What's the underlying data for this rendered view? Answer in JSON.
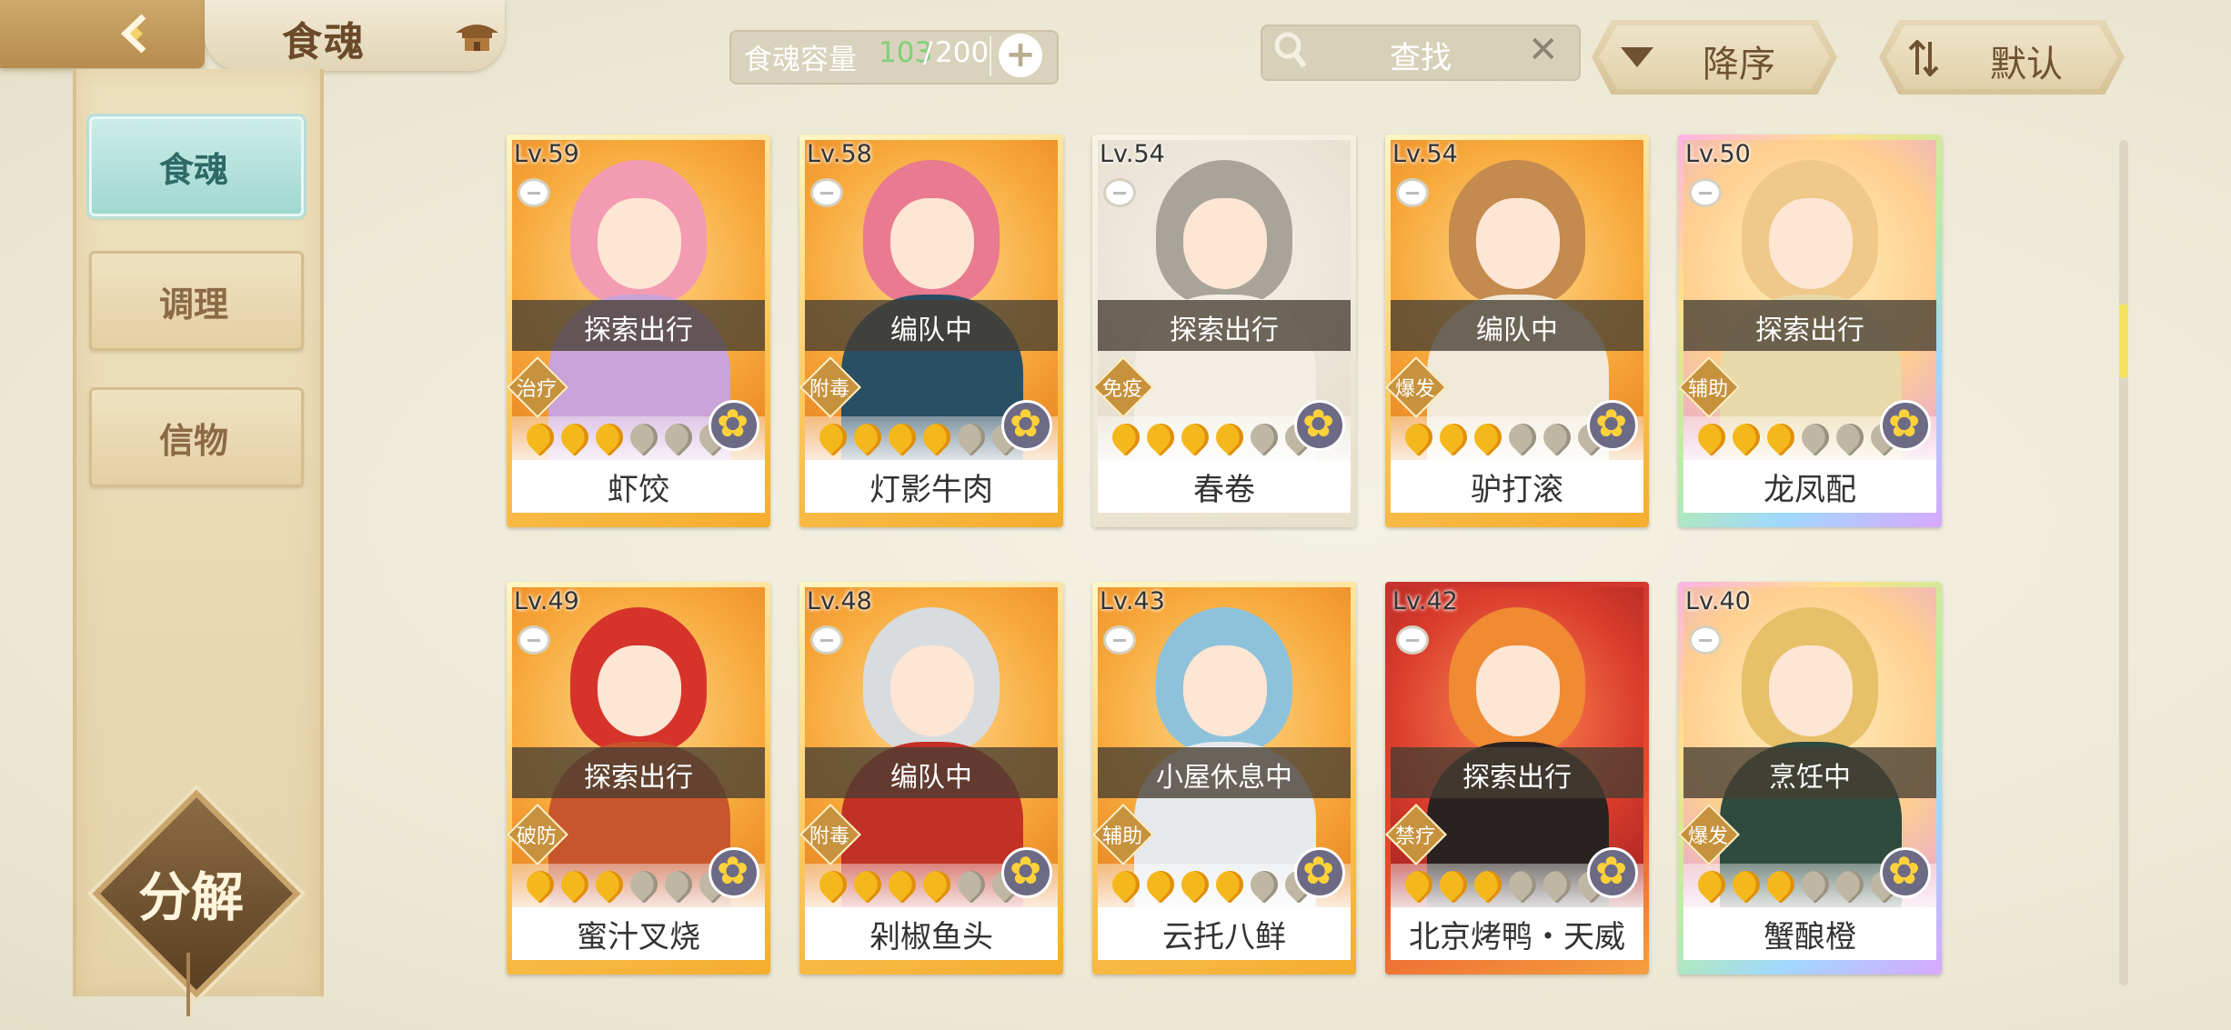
{
  "header": {
    "title": "食魂",
    "capacity": {
      "label": "食魂容量",
      "current": "103",
      "separator": "/",
      "max": "200"
    },
    "search": {
      "placeholder": "查找"
    },
    "sort_order_label": "降序",
    "sort_mode_label": "默认"
  },
  "sidebar": {
    "tabs": [
      {
        "label": "食魂",
        "active": true
      },
      {
        "label": "调理",
        "active": false
      },
      {
        "label": "信物",
        "active": false
      }
    ],
    "decompose_label": "分解"
  },
  "cards": [
    {
      "level": "Lv.59",
      "status": "探索出行",
      "role": "治疗",
      "name": "虾饺",
      "stars": 3,
      "max_stars": 6,
      "frame": "gold",
      "hair": "#f39bb3",
      "body": "#c9a2d8"
    },
    {
      "level": "Lv.58",
      "status": "编队中",
      "role": "附毒",
      "name": "灯影牛肉",
      "stars": 4,
      "max_stars": 6,
      "frame": "gold",
      "hair": "#e97a8f",
      "body": "#2a4e63"
    },
    {
      "level": "Lv.54",
      "status": "探索出行",
      "role": "免疫",
      "name": "春卷",
      "stars": 4,
      "max_stars": 6,
      "frame": "plain",
      "hair": "#a9a49a",
      "body": "#f3efe4"
    },
    {
      "level": "Lv.54",
      "status": "编队中",
      "role": "爆发",
      "name": "驴打滚",
      "stars": 3,
      "max_stars": 6,
      "frame": "gold",
      "hair": "#c48a4e",
      "body": "#f1ead8"
    },
    {
      "level": "Lv.50",
      "status": "探索出行",
      "role": "辅助",
      "name": "龙凤配",
      "stars": 3,
      "max_stars": 6,
      "frame": "rainbow",
      "hair": "#efc88a",
      "body": "#e9d8a8"
    },
    {
      "level": "Lv.49",
      "status": "探索出行",
      "role": "破防",
      "name": "蜜汁叉烧",
      "stars": 3,
      "max_stars": 6,
      "frame": "gold",
      "hair": "#d6342b",
      "body": "#c8562c"
    },
    {
      "level": "Lv.48",
      "status": "编队中",
      "role": "附毒",
      "name": "剁椒鱼头",
      "stars": 4,
      "max_stars": 6,
      "frame": "gold",
      "hair": "#d8dcdf",
      "body": "#c23125"
    },
    {
      "level": "Lv.43",
      "status": "小屋休息中",
      "role": "辅助",
      "name": "云托八鲜",
      "stars": 4,
      "max_stars": 6,
      "frame": "gold",
      "hair": "#8ec2db",
      "body": "#e6e9ec"
    },
    {
      "level": "Lv.42",
      "status": "探索出行",
      "role": "禁疗",
      "name": "北京烤鸭・天威",
      "stars": 3,
      "max_stars": 6,
      "frame": "red",
      "hair": "#f08a33",
      "body": "#2a2220"
    },
    {
      "level": "Lv.40",
      "status": "烹饪中",
      "role": "爆发",
      "name": "蟹酿橙",
      "stars": 3,
      "max_stars": 6,
      "frame": "rainbow",
      "hair": "#e7c06a",
      "body": "#2f4a3e"
    }
  ],
  "colors": {
    "capacity_current": "#7fd07b",
    "active_tab": "#9fd8d0",
    "scroll_thumb": "#f3e55f"
  }
}
